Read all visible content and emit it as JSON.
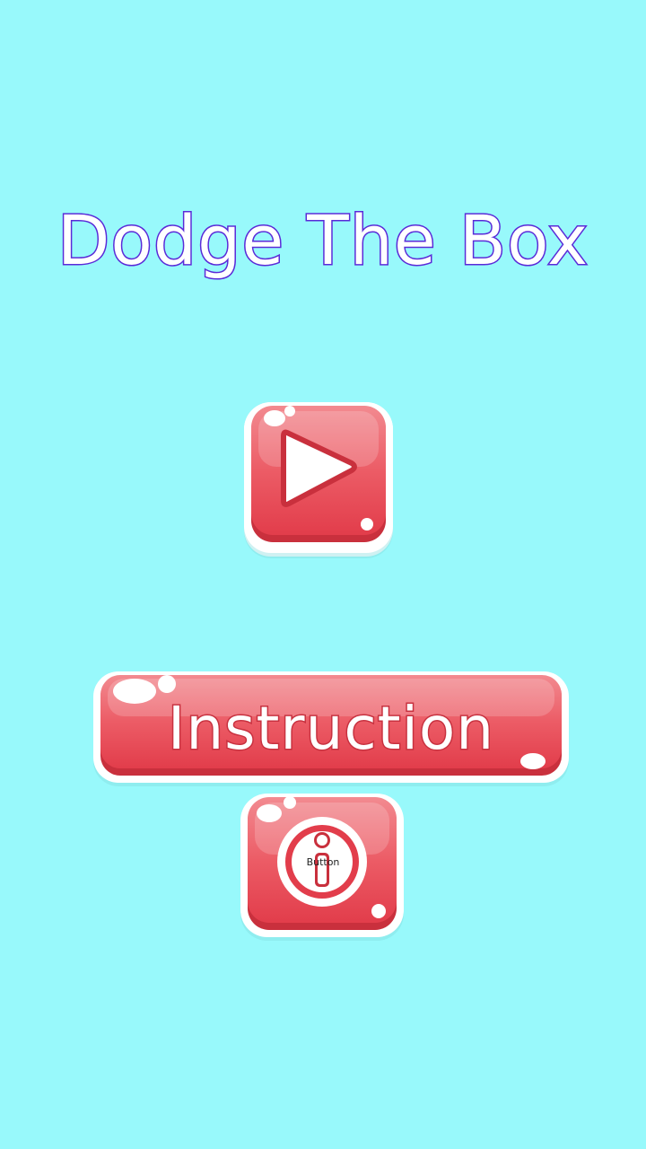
{
  "app": {
    "title": "Dodge The Box"
  },
  "buttons": {
    "play": {
      "icon": "play-icon"
    },
    "instruction": {
      "label": "Instruction"
    },
    "info": {
      "icon": "info-icon",
      "caption": "Button"
    }
  },
  "colors": {
    "background": "#98f9fb",
    "title_outline": "#5a2ad8",
    "button_red": "#e8434f",
    "button_red_light": "#f07f87",
    "button_border": "#ffffff"
  }
}
